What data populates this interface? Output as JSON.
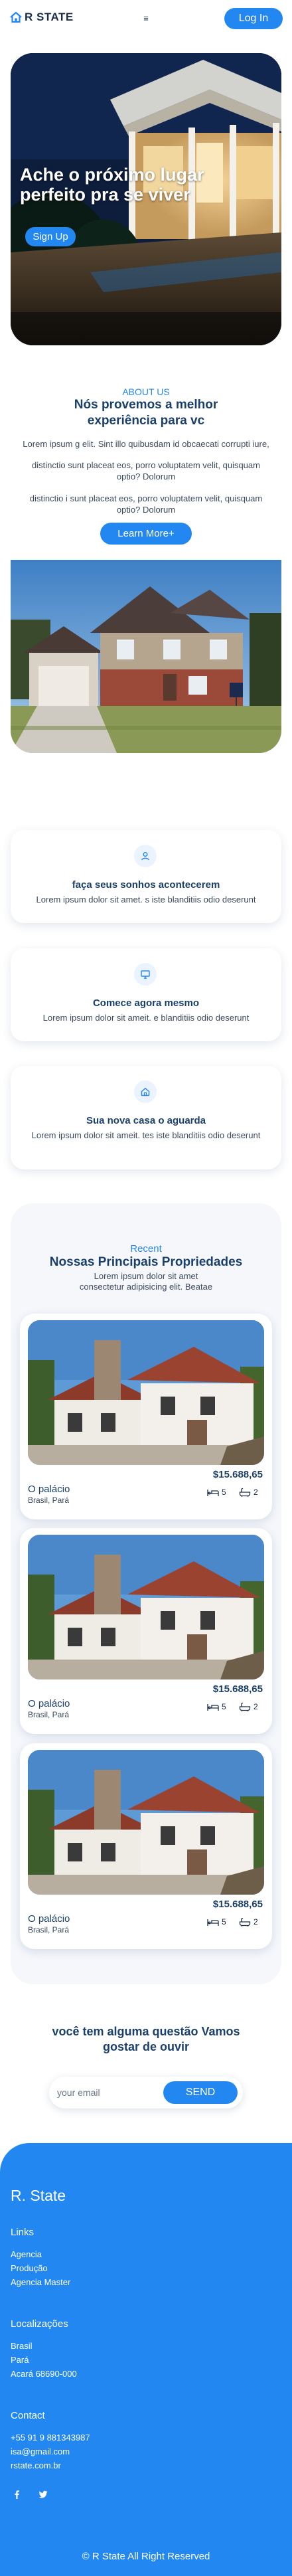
{
  "header": {
    "logo_text": "R STATE",
    "logo_icon": "house-logo-icon",
    "menu_icon": "≡",
    "login_label": "Log In"
  },
  "hero": {
    "title": "Ache o próximo lugar perfeito pra se viver",
    "signup_label": "Sign Up"
  },
  "about": {
    "eyebrow": "ABOUT US",
    "title": "Nós provemos a melhor experiência para vc",
    "paragraphs": [
      "Lorem ipsum g elit. Sint illo quibusdam id obcaecati corrupti iure,",
      "distinctio sunt placeat eos, porro voluptatem velit, quisquam optio? Dolorum",
      "distinctio i sunt placeat eos, porro voluptatem velit, quisquam optio? Dolorum"
    ],
    "learn_more_label": "Learn More+"
  },
  "features": [
    {
      "icon": "user-icon",
      "title": "faça seus sonhos acontecerem",
      "text": "Lorem ipsum dolor sit amet. s iste blanditiis odio deserunt"
    },
    {
      "icon": "monitor-icon",
      "title": "Comece agora mesmo",
      "text": "Lorem ipsum dolor sit ameit. e blanditiis odio deserunt"
    },
    {
      "icon": "home-icon",
      "title": "Sua nova casa o aguarda",
      "text": "Lorem ipsum dolor sit ameit. tes iste blanditiis odio deserunt"
    }
  ],
  "properties": {
    "eyebrow": "Recent",
    "title": "Nossas Principais Propriedades",
    "subtitle": "Lorem ipsum dolor sit amet consectetur adipisicing elit. Beatae",
    "items": [
      {
        "price": "$15.688,65",
        "name": "O palácio",
        "location": "Brasil, Pará",
        "beds": "5",
        "baths": "2"
      },
      {
        "price": "$15.688,65",
        "name": "O palácio",
        "location": "Brasil, Pará",
        "beds": "5",
        "baths": "2"
      },
      {
        "price": "$15.688,65",
        "name": "O palácio",
        "location": "Brasil, Pará",
        "beds": "5",
        "baths": "2"
      }
    ]
  },
  "contact": {
    "title": "você tem alguma questão Vamos gostar de ouvir",
    "email_placeholder": "your email",
    "send_label": "SEND"
  },
  "footer": {
    "brand": "R. State",
    "links_heading": "Links",
    "links": [
      "Agencia",
      "Produção",
      "Agencia Master"
    ],
    "locations_heading": "Localizações",
    "locations": [
      "Brasil",
      "Pará",
      "Acará 68690-000"
    ],
    "contact_heading": "Contact",
    "contacts": [
      "+55 91 9 881343987",
      "isa@gmail.com",
      "rstate.com.br"
    ],
    "social": [
      "facebook-icon",
      "twitter-icon"
    ],
    "copyright": "© R State All Right Reserved"
  },
  "colors": {
    "accent": "#2387f1",
    "heading": "#1a3f6b",
    "body_text": "#3b4a5e",
    "footer_bg": "#2387f1"
  }
}
